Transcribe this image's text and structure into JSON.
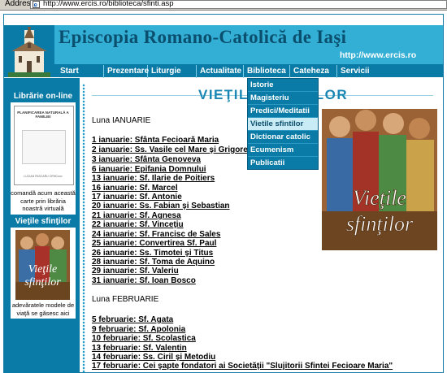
{
  "addressbar": {
    "label": "Address",
    "url": "http://www.ercis.ro/biblioteca/sfinti.asp"
  },
  "site": {
    "title": "Episcopia Romano-Catolică de Iaşi",
    "url": "http://www.ercis.ro"
  },
  "nav": [
    {
      "label": "Start"
    },
    {
      "label": "Prezentare"
    },
    {
      "label": "Liturgie"
    },
    {
      "label": "Actualitate"
    },
    {
      "label": "Biblioteca"
    },
    {
      "label": "Cateheza"
    },
    {
      "label": "Servicii"
    }
  ],
  "dropdown": [
    {
      "label": "Istorie"
    },
    {
      "label": "Magisteriu"
    },
    {
      "label": "Predici/Meditatii"
    },
    {
      "label": "Vietile sfintilor",
      "active": true
    },
    {
      "label": "Dictionar catolic"
    },
    {
      "label": "Ecumenism"
    },
    {
      "label": "Publicatii"
    }
  ],
  "sidebar": {
    "library_title": "Librărie on-line",
    "book_title": "PLANIFICAREA NATURALĂ A FAMILIEI",
    "book_footer": "LUCIAN PASCARU OFMConv",
    "library_desc": "comandă acum această carte prin librăria noastră virtuală",
    "saints_title": "Vieţile sfinţilor",
    "saints_desc": "adevăratele modele de viaţă se găsesc aici"
  },
  "main": {
    "title": "VIEŢILE SFINŢILOR",
    "january_title": "Luna IANUARIE",
    "january": [
      "1 ianuarie: Sfânta Fecioară Maria",
      "2 ianuarie: Ss. Vasile cel Mare şi Grigore de Nazianz",
      "3 ianuarie: Sfânta Genoveva",
      "6 ianuarie: Epifania Domnului",
      "13 ianuarie: Sf. Ilarie de Poitiers",
      "16 ianuarie: Sf. Marcel",
      "17 ianuarie: Sf. Antonie",
      "20 ianuarie: Ss. Fabian şi Sebastian",
      "21 ianuarie: Sf. Agnesa",
      "22 ianuarie: Sf. Vinceţiu",
      "24 ianuarie: Sf. Francisc de Sales",
      "25 ianuarie: Convertirea Sf. Paul",
      "26 ianuarie: Ss. Timotei şi Titus",
      "28 ianuarie: Sf. Toma de Aquino",
      "29 ianuarie: Sf. Valeriu",
      "31 ianuarie: Sf. Ioan Bosco"
    ],
    "february_title": "Luna FEBRUARIE",
    "february": [
      "5 februarie: Sf. Agata",
      "9 februarie: Sf. Apolonia",
      "10 februarie: Sf. Scolastica",
      "13 februarie: Sf. Valentin",
      "14 februarie: Ss. Ciril şi Metodiu",
      "17 februarie: Cei şapte fondatori ai Societăţii \"Slujitorii Sfintei Fecioare Maria\""
    ],
    "art_caption_1": "Vieţile",
    "art_caption_2": "sfinţilor"
  },
  "colors": {
    "header_dark": "#0a7aa6",
    "header_light": "#33afd5",
    "title_text": "#0b4f6e",
    "accent": "#1a86b3"
  }
}
